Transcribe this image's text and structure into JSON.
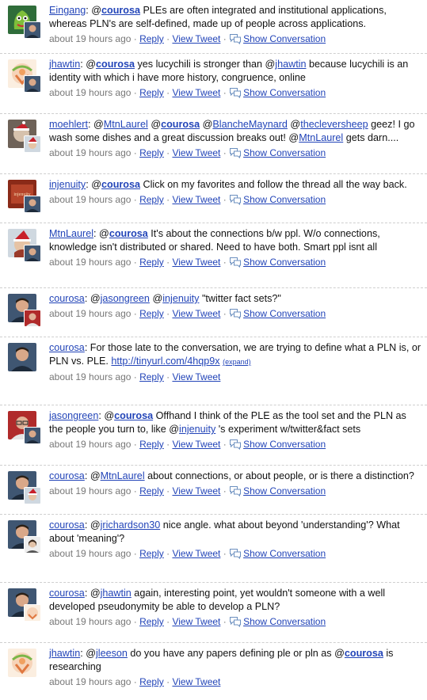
{
  "tweets": [
    {
      "author": "Eingang",
      "segments": [
        {
          "t": ": "
        },
        {
          "t": "@",
          "k": "at"
        },
        {
          "t": "courosa",
          "k": "mb"
        },
        {
          "t": " PLEs are often integrated and institutional applications, whereas PLN's are self-defined, made up of people across applications."
        }
      ],
      "time": "about 19 hours ago",
      "reply": "Reply",
      "view": "View Tweet",
      "conv": "Show Conversation",
      "avatar": "eingang-avatar",
      "mini": "courosa-mini-avatar"
    },
    {
      "author": "jhawtin",
      "segments": [
        {
          "t": ": "
        },
        {
          "t": "@",
          "k": "at"
        },
        {
          "t": "courosa",
          "k": "mb"
        },
        {
          "t": " yes lucychili is stronger than "
        },
        {
          "t": "@",
          "k": "at"
        },
        {
          "t": "jhawtin",
          "k": "m"
        },
        {
          "t": " because lucychili is an identity with which i have more history, congruence, online"
        }
      ],
      "time": "about 19 hours ago",
      "reply": "Reply",
      "view": "View Tweet",
      "conv": "Show Conversation",
      "avatar": "jhawtin-avatar",
      "mini": "courosa-mini-avatar"
    },
    {
      "author": "moehlert",
      "segments": [
        {
          "t": ": "
        },
        {
          "t": "@",
          "k": "at"
        },
        {
          "t": "MtnLaurel",
          "k": "m"
        },
        {
          "t": " "
        },
        {
          "t": "@",
          "k": "at"
        },
        {
          "t": "courosa",
          "k": "mb"
        },
        {
          "t": " "
        },
        {
          "t": "@",
          "k": "at"
        },
        {
          "t": "BlancheMaynard",
          "k": "m"
        },
        {
          "t": " "
        },
        {
          "t": "@",
          "k": "at"
        },
        {
          "t": "thecleversheep",
          "k": "m"
        },
        {
          "t": " geez! I go wash some dishes and a great discussion breaks out! "
        },
        {
          "t": "@",
          "k": "at"
        },
        {
          "t": "MtnLaurel",
          "k": "m"
        },
        {
          "t": " gets darn...."
        }
      ],
      "time": "about 19 hours ago",
      "reply": "Reply",
      "view": "View Tweet",
      "conv": "Show Conversation",
      "avatar": "moehlert-avatar",
      "mini": "mtnlaurel-mini-avatar"
    },
    {
      "author": "injenuity",
      "segments": [
        {
          "t": ": "
        },
        {
          "t": "@",
          "k": "at"
        },
        {
          "t": "courosa",
          "k": "mb"
        },
        {
          "t": " Click on my favorites and follow the thread all the way back."
        }
      ],
      "time": "about 19 hours ago",
      "reply": "Reply",
      "view": "View Tweet",
      "conv": "Show Conversation",
      "avatar": "injenuity-avatar",
      "mini": "courosa-mini-avatar"
    },
    {
      "author": "MtnLaurel",
      "segments": [
        {
          "t": ": "
        },
        {
          "t": "@",
          "k": "at"
        },
        {
          "t": "courosa",
          "k": "mb"
        },
        {
          "t": " It's about the connections b/w ppl. W/o connections, knowledge isn't distributed or shared. Need to have both. Smart ppl isnt all"
        }
      ],
      "time": "about 19 hours ago",
      "reply": "Reply",
      "view": "View Tweet",
      "conv": "Show Conversation",
      "avatar": "mtnlaurel-avatar",
      "mini": "courosa-mini-avatar"
    },
    {
      "author": "courosa",
      "segments": [
        {
          "t": ": "
        },
        {
          "t": "@",
          "k": "at"
        },
        {
          "t": "jasongreen",
          "k": "m"
        },
        {
          "t": " "
        },
        {
          "t": "@",
          "k": "at"
        },
        {
          "t": "injenuity",
          "k": "m"
        },
        {
          "t": " \"twitter fact sets?\""
        }
      ],
      "time": "about 19 hours ago",
      "reply": "Reply",
      "view": "View Tweet",
      "conv": "Show Conversation",
      "avatar": "courosa-avatar",
      "mini": "jasongreen-mini-avatar"
    },
    {
      "author": "courosa",
      "segments": [
        {
          "t": ": For those late to the conversation, we are trying to define what a PLN is, or PLN vs. PLE. "
        },
        {
          "t": "http://tinyurl.com/4hqp9x",
          "k": "link"
        },
        {
          "t": " "
        },
        {
          "t": "(expand)",
          "k": "expand"
        }
      ],
      "time": "about 19 hours ago",
      "reply": "Reply",
      "view": "View Tweet",
      "avatar": "courosa-avatar"
    },
    {
      "author": "jasongreen",
      "segments": [
        {
          "t": ": "
        },
        {
          "t": "@",
          "k": "at"
        },
        {
          "t": "courosa",
          "k": "mb"
        },
        {
          "t": " Offhand I think of the PLE as the tool set and the PLN as the people you turn to, like "
        },
        {
          "t": "@",
          "k": "at"
        },
        {
          "t": "injenuity",
          "k": "m"
        },
        {
          "t": " 's experiment w/twitter&fact sets"
        }
      ],
      "time": "about 19 hours ago",
      "reply": "Reply",
      "view": "View Tweet",
      "conv": "Show Conversation",
      "avatar": "jasongreen-avatar",
      "mini": "courosa-mini-avatar"
    },
    {
      "author": "courosa",
      "segments": [
        {
          "t": ": "
        },
        {
          "t": "@",
          "k": "at"
        },
        {
          "t": "MtnLaurel",
          "k": "m"
        },
        {
          "t": " about connections, or about people, or is there a distinction?"
        }
      ],
      "time": "about 19 hours ago",
      "reply": "Reply",
      "view": "View Tweet",
      "conv": "Show Conversation",
      "avatar": "courosa-avatar",
      "mini": "mtnlaurel-mini-avatar"
    },
    {
      "author": "courosa",
      "segments": [
        {
          "t": ": "
        },
        {
          "t": "@",
          "k": "at"
        },
        {
          "t": "jrichardson30",
          "k": "m"
        },
        {
          "t": " nice angle. what about beyond 'understanding'? What about 'meaning'?"
        }
      ],
      "time": "about 19 hours ago",
      "reply": "Reply",
      "view": "View Tweet",
      "conv": "Show Conversation",
      "avatar": "courosa-avatar",
      "mini": "jrichardson30-mini-avatar"
    },
    {
      "author": "courosa",
      "segments": [
        {
          "t": ": "
        },
        {
          "t": "@",
          "k": "at"
        },
        {
          "t": "jhawtin",
          "k": "m"
        },
        {
          "t": " again, interesting point, yet wouldn't someone with a well developed pseudonymity be able to develop a PLN?"
        }
      ],
      "time": "about 19 hours ago",
      "reply": "Reply",
      "view": "View Tweet",
      "conv": "Show Conversation",
      "avatar": "courosa-avatar",
      "mini": "jhawtin-mini-avatar"
    },
    {
      "author": "jhawtin",
      "segments": [
        {
          "t": ": "
        },
        {
          "t": "@",
          "k": "at"
        },
        {
          "t": "jleeson",
          "k": "m"
        },
        {
          "t": " do you have any papers defining ple or pln as "
        },
        {
          "t": "@",
          "k": "at"
        },
        {
          "t": "courosa",
          "k": "mb"
        },
        {
          "t": " is researching"
        }
      ],
      "time": "about 19 hours ago",
      "reply": "Reply",
      "view": "View Tweet",
      "avatar": "jhawtin-avatar"
    }
  ],
  "colors": {
    "link": "#2244b8",
    "meta": "#777777",
    "divider": "#cfcfcf"
  }
}
